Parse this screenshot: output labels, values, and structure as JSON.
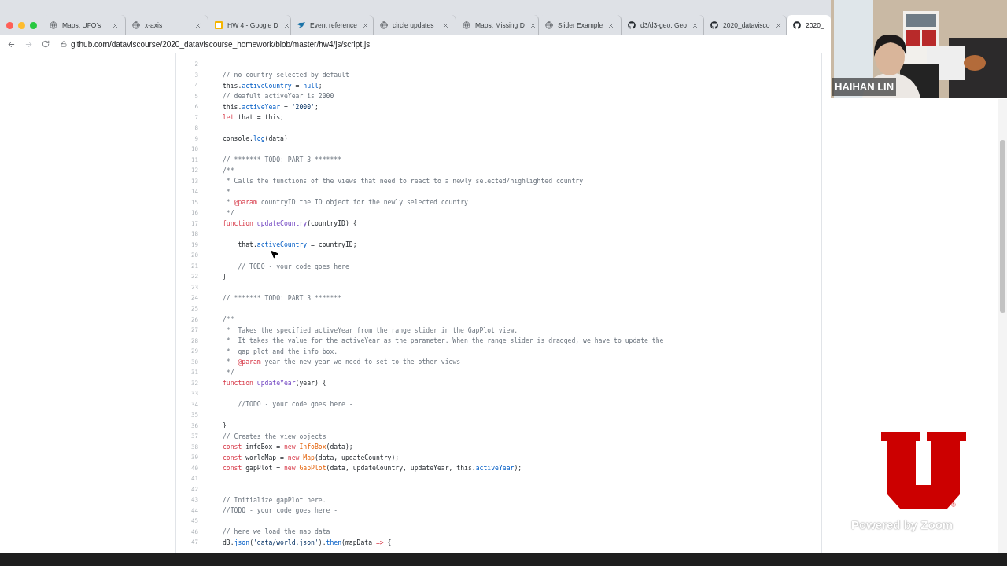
{
  "browser": {
    "tabs": [
      {
        "title": "Maps, UFO's",
        "kind": "globe",
        "selected": false
      },
      {
        "title": "x-axis",
        "kind": "globe",
        "selected": false
      },
      {
        "title": "HW 4 - Google D",
        "kind": "doc",
        "selected": false
      },
      {
        "title": "Event reference",
        "kind": "bird",
        "selected": false
      },
      {
        "title": "circle updates",
        "kind": "globe",
        "selected": false
      },
      {
        "title": "Maps, Missing D",
        "kind": "globe",
        "selected": false
      },
      {
        "title": "Slider Example",
        "kind": "globe",
        "selected": false
      },
      {
        "title": "d3/d3-geo: Geo",
        "kind": "github",
        "selected": false
      },
      {
        "title": "2020_datavisco",
        "kind": "github",
        "selected": false
      },
      {
        "title": "2020_",
        "kind": "github",
        "selected": true
      }
    ],
    "url": "github.com/dataviscourse/2020_dataviscourse_homework/blob/master/hw4/js/script.js"
  },
  "code": {
    "lines": [
      {
        "number": "2"
      },
      {
        "number": "3",
        "tokens": [
          {
            "kind": "comment",
            "text": "// no country selected by default"
          }
        ]
      },
      {
        "number": "4",
        "tokens": [
          {
            "kind": "plain",
            "text": "this."
          },
          {
            "kind": "prop",
            "text": "activeCountry"
          },
          {
            "kind": "plain",
            "text": " = "
          },
          {
            "kind": "prop",
            "text": "null"
          },
          {
            "kind": "plain",
            "text": ";"
          }
        ]
      },
      {
        "number": "5",
        "tokens": [
          {
            "kind": "comment",
            "text": "// deafult activeYear is 2000"
          }
        ]
      },
      {
        "number": "6",
        "tokens": [
          {
            "kind": "plain",
            "text": "this."
          },
          {
            "kind": "prop",
            "text": "activeYear"
          },
          {
            "kind": "plain",
            "text": " = "
          },
          {
            "kind": "string",
            "text": "'2000'"
          },
          {
            "kind": "plain",
            "text": ";"
          }
        ]
      },
      {
        "number": "7",
        "tokens": [
          {
            "kind": "keyword",
            "text": "let"
          },
          {
            "kind": "plain",
            "text": " that = this;"
          }
        ]
      },
      {
        "number": "8"
      },
      {
        "number": "9",
        "tokens": [
          {
            "kind": "plain",
            "text": "console."
          },
          {
            "kind": "prop",
            "text": "log"
          },
          {
            "kind": "plain",
            "text": "(data)"
          }
        ]
      },
      {
        "number": "10"
      },
      {
        "number": "11",
        "tokens": [
          {
            "kind": "comment",
            "text": "// ******* TODO: PART 3 *******"
          }
        ]
      },
      {
        "number": "12",
        "tokens": [
          {
            "kind": "comment",
            "text": "/**"
          }
        ]
      },
      {
        "number": "13",
        "tokens": [
          {
            "kind": "comment",
            "text": " * Calls the functions of the views that need to react to a newly selected/highlighted country"
          }
        ]
      },
      {
        "number": "14",
        "tokens": [
          {
            "kind": "comment",
            "text": " *"
          }
        ]
      },
      {
        "number": "15",
        "tokens": [
          {
            "kind": "comment",
            "text": " * "
          },
          {
            "kind": "keyword",
            "text": "@param"
          },
          {
            "kind": "comment",
            "text": " countryID the ID object for the newly selected country"
          }
        ]
      },
      {
        "number": "16",
        "tokens": [
          {
            "kind": "comment",
            "text": " */"
          }
        ]
      },
      {
        "number": "17",
        "tokens": [
          {
            "kind": "keyword",
            "text": "function "
          },
          {
            "kind": "entity",
            "text": "updateCountry"
          },
          {
            "kind": "plain",
            "text": "(countryID) {"
          }
        ]
      },
      {
        "number": "18"
      },
      {
        "number": "19",
        "tokens": [
          {
            "kind": "plain",
            "text": "    that."
          },
          {
            "kind": "prop",
            "text": "activeCountry"
          },
          {
            "kind": "plain",
            "text": " = countryID;"
          }
        ]
      },
      {
        "number": "20"
      },
      {
        "number": "21",
        "tokens": [
          {
            "kind": "comment",
            "text": "    // TODO - your code goes here"
          }
        ]
      },
      {
        "number": "22",
        "tokens": [
          {
            "kind": "plain",
            "text": "}"
          }
        ]
      },
      {
        "number": "23"
      },
      {
        "number": "24",
        "tokens": [
          {
            "kind": "comment",
            "text": "// ******* TODO: PART 3 *******"
          }
        ]
      },
      {
        "number": "25"
      },
      {
        "number": "26",
        "tokens": [
          {
            "kind": "comment",
            "text": "/**"
          }
        ]
      },
      {
        "number": "27",
        "tokens": [
          {
            "kind": "comment",
            "text": " *  Takes the specified activeYear from the range slider in the GapPlot view."
          }
        ]
      },
      {
        "number": "28",
        "tokens": [
          {
            "kind": "comment",
            "text": " *  It takes the value for the activeYear as the parameter. When the range slider is dragged, we have to update the"
          }
        ]
      },
      {
        "number": "29",
        "tokens": [
          {
            "kind": "comment",
            "text": " *  gap plot and the info box."
          }
        ]
      },
      {
        "number": "30",
        "tokens": [
          {
            "kind": "comment",
            "text": " *  "
          },
          {
            "kind": "keyword",
            "text": "@param"
          },
          {
            "kind": "comment",
            "text": " year the new year we need to set to the other views"
          }
        ]
      },
      {
        "number": "31",
        "tokens": [
          {
            "kind": "comment",
            "text": " */"
          }
        ]
      },
      {
        "number": "32",
        "tokens": [
          {
            "kind": "keyword",
            "text": "function "
          },
          {
            "kind": "entity",
            "text": "updateYear"
          },
          {
            "kind": "plain",
            "text": "(year) {"
          }
        ]
      },
      {
        "number": "33"
      },
      {
        "number": "34",
        "tokens": [
          {
            "kind": "comment",
            "text": "    //TODO - your code goes here -"
          }
        ]
      },
      {
        "number": "35"
      },
      {
        "number": "36",
        "tokens": [
          {
            "kind": "plain",
            "text": "}"
          }
        ]
      },
      {
        "number": "37",
        "tokens": [
          {
            "kind": "comment",
            "text": "// Creates the view objects"
          }
        ]
      },
      {
        "number": "38",
        "tokens": [
          {
            "kind": "keyword",
            "text": "const"
          },
          {
            "kind": "plain",
            "text": " infoBox = "
          },
          {
            "kind": "keyword",
            "text": "new "
          },
          {
            "kind": "class",
            "text": "InfoBox"
          },
          {
            "kind": "plain",
            "text": "(data);"
          }
        ]
      },
      {
        "number": "39",
        "tokens": [
          {
            "kind": "keyword",
            "text": "const"
          },
          {
            "kind": "plain",
            "text": " worldMap = "
          },
          {
            "kind": "keyword",
            "text": "new "
          },
          {
            "kind": "class",
            "text": "Map"
          },
          {
            "kind": "plain",
            "text": "(data, updateCountry);"
          }
        ]
      },
      {
        "number": "40",
        "tokens": [
          {
            "kind": "keyword",
            "text": "const"
          },
          {
            "kind": "plain",
            "text": " gapPlot = "
          },
          {
            "kind": "keyword",
            "text": "new "
          },
          {
            "kind": "class",
            "text": "GapPlot"
          },
          {
            "kind": "plain",
            "text": "(data, updateCountry, updateYear, this."
          },
          {
            "kind": "prop",
            "text": "activeYear"
          },
          {
            "kind": "plain",
            "text": ");"
          }
        ]
      },
      {
        "number": "41"
      },
      {
        "number": "42"
      },
      {
        "number": "43",
        "tokens": [
          {
            "kind": "comment",
            "text": "// Initialize gapPlot here."
          }
        ]
      },
      {
        "number": "44",
        "tokens": [
          {
            "kind": "comment",
            "text": "//TODO - your code goes here -"
          }
        ]
      },
      {
        "number": "45"
      },
      {
        "number": "46",
        "tokens": [
          {
            "kind": "comment",
            "text": "// here we load the map data"
          }
        ]
      },
      {
        "number": "47",
        "tokens": [
          {
            "kind": "plain",
            "text": "d3."
          },
          {
            "kind": "prop",
            "text": "json"
          },
          {
            "kind": "plain",
            "text": "("
          },
          {
            "kind": "string",
            "text": "'data/world.json'"
          },
          {
            "kind": "plain",
            "text": ")."
          },
          {
            "kind": "prop",
            "text": "then"
          },
          {
            "kind": "plain",
            "text": "(mapData "
          },
          {
            "kind": "keyword",
            "text": "=>"
          },
          {
            "kind": "plain",
            "text": " {"
          }
        ]
      }
    ]
  },
  "video": {
    "kind": "picture",
    "name_label": "HAIHAN LIN"
  },
  "logo": {
    "mark": "®"
  },
  "branding": "Powered by Zoom"
}
